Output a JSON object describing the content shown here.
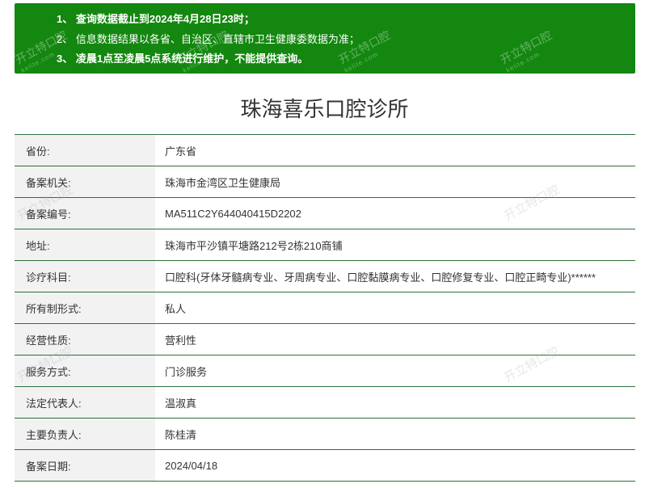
{
  "notice": {
    "lines": [
      "1、 查询数据截止到2024年4月28日23时；",
      "2、 信息数据结果以各省、自治区、直辖市卫生健康委数据为准；",
      "3、 凌晨1点至凌晨5点系统进行维护，不能提供查询。"
    ]
  },
  "watermark": {
    "text": "开立特口腔",
    "sub": "kelite.com"
  },
  "clinic": {
    "title": "珠海喜乐口腔诊所",
    "rows": [
      {
        "label": "省份:",
        "value": "广东省"
      },
      {
        "label": "备案机关:",
        "value": "珠海市金湾区卫生健康局"
      },
      {
        "label": "备案编号:",
        "value": "MA511C2Y644040415D2202"
      },
      {
        "label": "地址:",
        "value": "珠海市平沙镇平塘路212号2栋210商铺"
      },
      {
        "label": "诊疗科目:",
        "value": "口腔科(牙体牙髓病专业、牙周病专业、口腔黏膜病专业、口腔修复专业、口腔正畸专业)******"
      },
      {
        "label": "所有制形式:",
        "value": "私人"
      },
      {
        "label": "经营性质:",
        "value": "营利性"
      },
      {
        "label": "服务方式:",
        "value": "门诊服务"
      },
      {
        "label": "法定代表人:",
        "value": "温淑真"
      },
      {
        "label": "主要负责人:",
        "value": "陈桂清"
      },
      {
        "label": "备案日期:",
        "value": "2024/04/18"
      }
    ]
  },
  "colors": {
    "notice_bg": "#13870f",
    "row_border": "#2f6f3a",
    "label_bg": "#f2f2f2"
  }
}
